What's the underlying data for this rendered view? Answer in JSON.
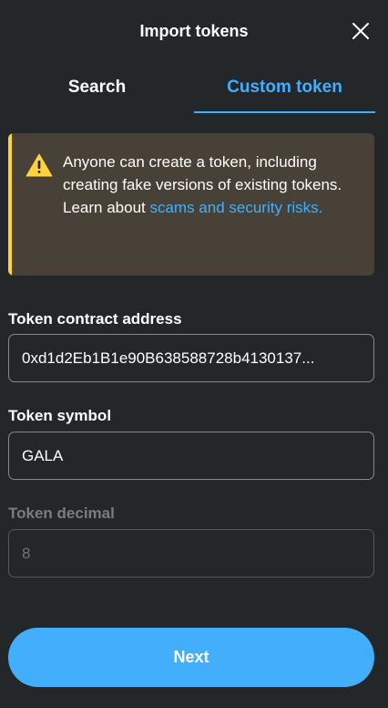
{
  "header": {
    "title": "Import tokens",
    "close_icon": "close-icon"
  },
  "tabs": [
    {
      "label": "Search",
      "active": false
    },
    {
      "label": "Custom token",
      "active": true
    }
  ],
  "warning": {
    "icon": "warning-icon",
    "text": "Anyone can create a token, including creating fake versions of existing tokens. Learn about ",
    "link_text": "scams and security risks."
  },
  "form": {
    "address": {
      "label": "Token contract address",
      "value": "0xd1d2Eb1B1e90B638588728b4130137..."
    },
    "symbol": {
      "label": "Token symbol",
      "value": "GALA"
    },
    "decimal": {
      "label": "Token decimal",
      "value": "8",
      "disabled": true
    }
  },
  "footer": {
    "next_label": "Next"
  },
  "colors": {
    "background": "#24272a",
    "accent": "#43aefc",
    "warning_bg": "#474137",
    "warning_bar": "#ffd33d"
  }
}
